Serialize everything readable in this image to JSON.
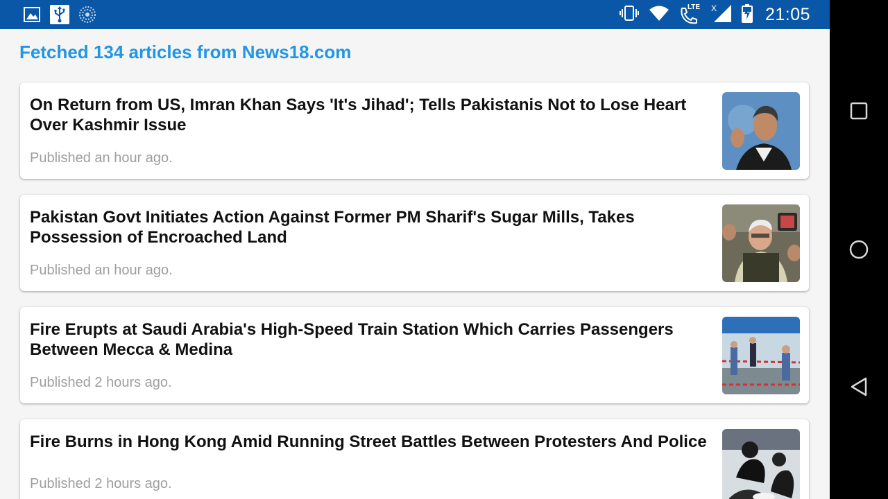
{
  "status_bar": {
    "clock": "21:05",
    "lte_label": "LTE",
    "left_icons": [
      "image-icon",
      "usb-icon",
      "loading-icon"
    ],
    "right_icons": [
      "vibrate-icon",
      "wifi-icon",
      "volte-call-icon",
      "signal-icon",
      "battery-charging-icon"
    ],
    "color": "#0a57a8"
  },
  "header": {
    "title": "Fetched 134 articles from News18.com",
    "color": "#2196e3"
  },
  "articles": [
    {
      "title": "On Return from US, Imran Khan Says 'It's Jihad'; Tells Pakistanis Not to Lose Heart Over Kashmir Issue",
      "published": "Published an hour ago."
    },
    {
      "title": "Pakistan Govt Initiates Action Against Former PM Sharif's Sugar Mills, Takes Possession of Encroached Land",
      "published": "Published an hour ago."
    },
    {
      "title": "Fire Erupts at Saudi Arabia's High-Speed Train Station Which Carries Passengers Between Mecca & Medina",
      "published": "Published 2 hours ago."
    },
    {
      "title": "Fire Burns in Hong Kong Amid Running Street Battles Between Protesters And Police",
      "published": "Published 2 hours ago."
    }
  ],
  "nav_bar": {
    "icons": [
      "recents-icon",
      "home-icon",
      "back-icon"
    ]
  }
}
